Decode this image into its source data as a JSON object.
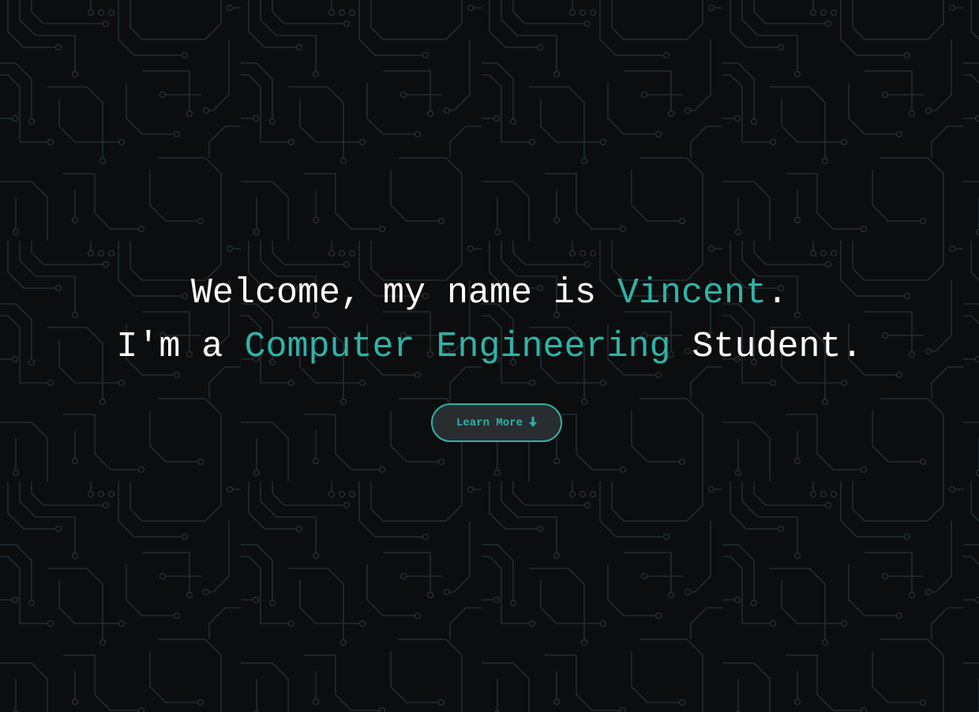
{
  "hero": {
    "line1": {
      "prefix": "Welcome, my name is ",
      "highlight": "Vincent",
      "suffix": "."
    },
    "line2": {
      "prefix": "I'm a ",
      "highlight": "Computer Engineering",
      "suffix": " Student."
    },
    "cta_label": "Learn More",
    "cta_icon": "arrow-down-icon"
  },
  "colors": {
    "background": "#0c0d0e",
    "circuit_trace": "#1f2a30",
    "accent": "#2fb3a8",
    "text": "#ffffff",
    "button_fill": "#2a2d30"
  }
}
